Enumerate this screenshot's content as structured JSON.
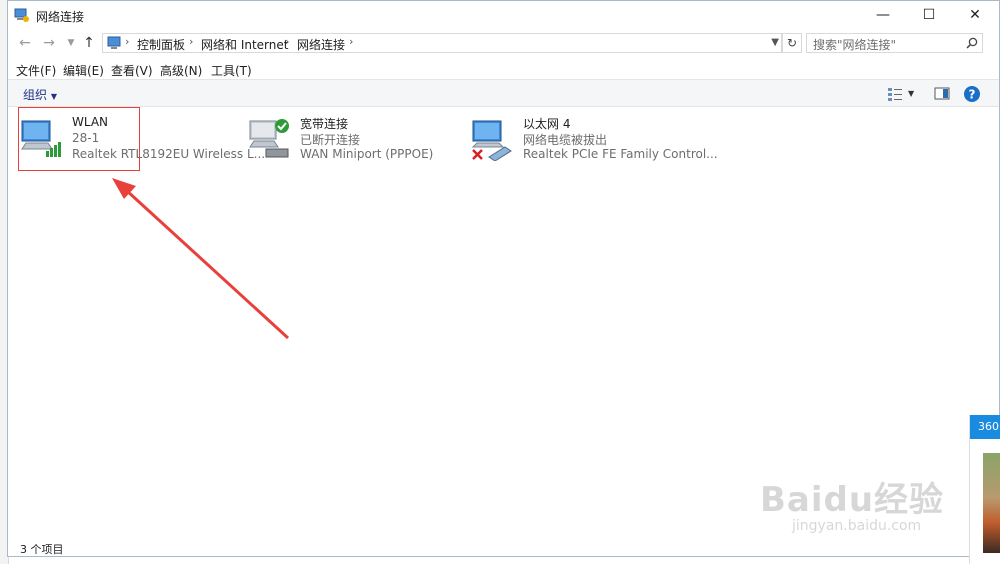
{
  "window": {
    "title": "网络连接"
  },
  "address": {
    "crumbs": [
      "控制面板",
      "网络和 Internet",
      "网络连接"
    ],
    "search_placeholder": "搜索\"网络连接\""
  },
  "menu": [
    "文件(F)",
    "编辑(E)",
    "查看(V)",
    "高级(N)",
    "工具(T)"
  ],
  "toolbar": {
    "organize": "组织"
  },
  "connections": [
    {
      "name": "WLAN",
      "status": "28-1",
      "device": "Realtek RTL8192EU Wireless L...",
      "icon": "wifi-adapter-icon"
    },
    {
      "name": "宽带连接",
      "status": "已断开连接",
      "device": "WAN Miniport (PPPOE)",
      "icon": "broadband-connection-icon"
    },
    {
      "name": "以太网 4",
      "status": "网络电缆被拔出",
      "device": "Realtek PCIe FE Family Control...",
      "icon": "ethernet-adapter-icon"
    }
  ],
  "statusbar": {
    "count": "3 个项目"
  },
  "sidecard": {
    "label": "360"
  },
  "watermark": {
    "main": "Baidu经验",
    "sub": "jingyan.baidu.com"
  },
  "colors": {
    "highlight": "#e8403a",
    "link_blue": "#1e3287",
    "accent": "#1a8ce0"
  }
}
